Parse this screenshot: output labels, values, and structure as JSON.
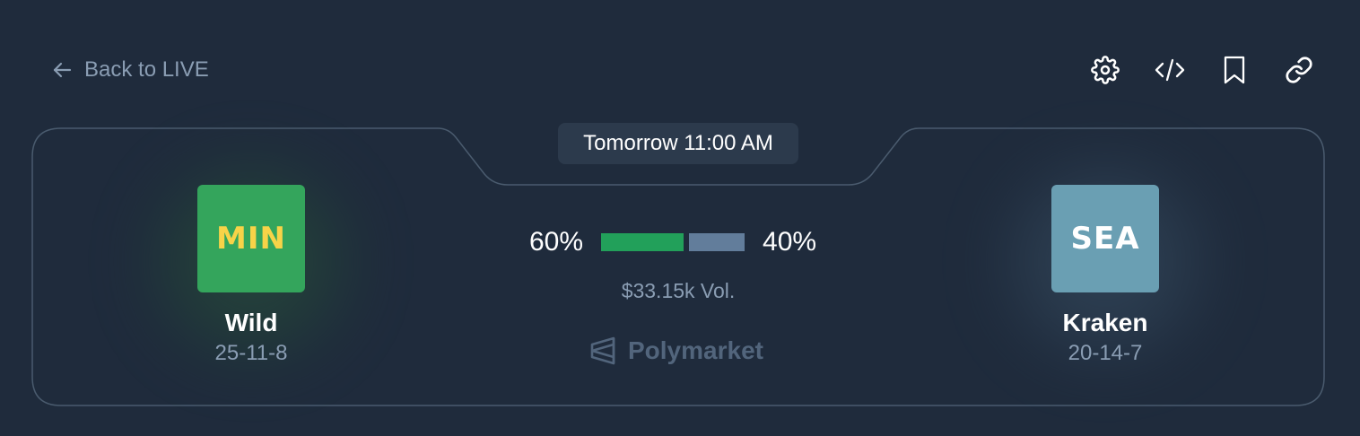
{
  "nav": {
    "back_label": "Back to LIVE"
  },
  "toolbar": {
    "icons": [
      "gear-icon",
      "code-icon",
      "bookmark-icon",
      "link-icon"
    ]
  },
  "match": {
    "time": "Tomorrow 11:00 AM",
    "home": {
      "abbr": "MIN",
      "name": "Wild",
      "record": "25-11-8",
      "logo_bg": "#34a55c",
      "logo_text_color": "#f7d348"
    },
    "away": {
      "abbr": "SEA",
      "name": "Kraken",
      "record": "20-14-7",
      "logo_bg": "#6a9fb3",
      "logo_text_color": "#ffffff"
    },
    "odds": {
      "home_pct": "60%",
      "away_pct": "40%",
      "home_share": 0.6,
      "away_share": 0.4,
      "home_color": "#22a05a",
      "away_color": "#627d9b"
    },
    "volume": "$33.15k Vol.",
    "source": "Polymarket"
  },
  "colors": {
    "background": "#1f2b3c",
    "muted_text": "#8a9db3",
    "outline": "#4a5b6e"
  }
}
